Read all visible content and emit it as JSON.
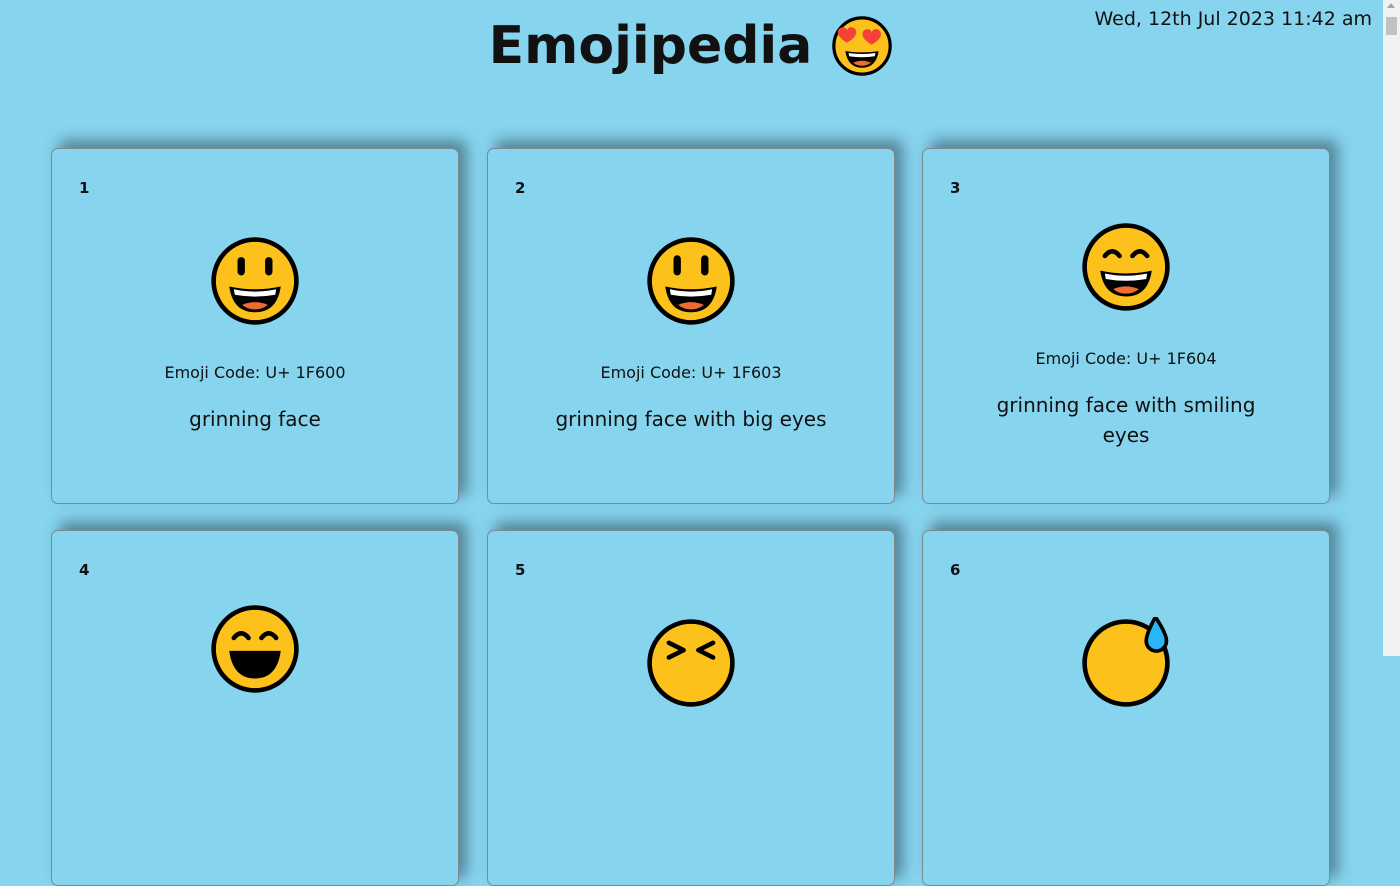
{
  "header": {
    "title": "Emojipedia",
    "title_emoji": "smiling-face-with-heart-eyes-icon",
    "datetime": "Wed, 12th Jul 2023 11:42 am"
  },
  "colors": {
    "background": "#87d4ee",
    "emoji_face": "#fcc21b",
    "emoji_outline": "#000000",
    "tongue": "#ed6c30",
    "heart": "#f44336",
    "sweat_drop": "#29b6f6"
  },
  "cards": [
    {
      "number": "1",
      "icon": "grinning-face-icon",
      "code_label": "Emoji Code: U+ 1F600",
      "name": "grinning face"
    },
    {
      "number": "2",
      "icon": "grinning-face-with-big-eyes-icon",
      "code_label": "Emoji Code: U+ 1F603",
      "name": "grinning face with big eyes"
    },
    {
      "number": "3",
      "icon": "grinning-face-with-smiling-eyes-icon",
      "code_label": "Emoji Code: U+ 1F604",
      "name": "grinning face with smiling eyes"
    },
    {
      "number": "4",
      "icon": "beaming-face-icon",
      "code_label": "",
      "name": ""
    },
    {
      "number": "5",
      "icon": "squinting-face-icon",
      "code_label": "",
      "name": ""
    },
    {
      "number": "6",
      "icon": "grinning-face-with-sweat-icon",
      "code_label": "",
      "name": ""
    }
  ]
}
